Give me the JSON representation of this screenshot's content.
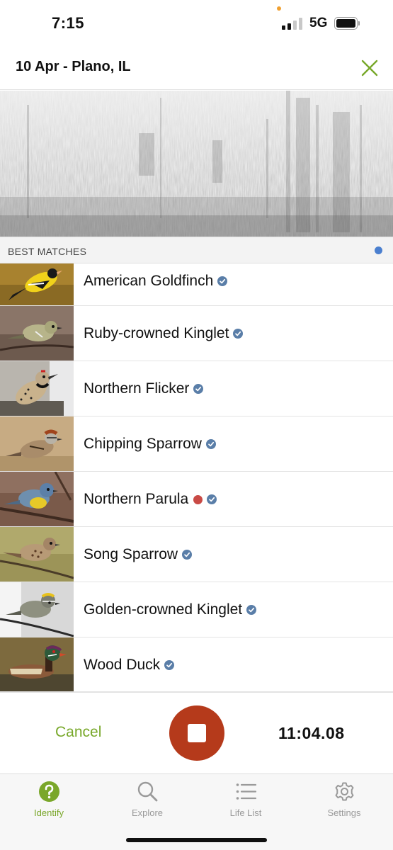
{
  "status_bar": {
    "time": "7:15",
    "network": "5G"
  },
  "header": {
    "title": "10 Apr - Plano, IL",
    "close_icon": "close-x-icon",
    "accent_color": "#78a82a"
  },
  "best_matches": {
    "title": "BEST MATCHES",
    "indicator_color": "#4a7fcf",
    "items": [
      {
        "name": "American Goldfinch",
        "verified": true,
        "new_flag": false
      },
      {
        "name": "Ruby-crowned Kinglet",
        "verified": true,
        "new_flag": false
      },
      {
        "name": "Northern Flicker",
        "verified": true,
        "new_flag": false
      },
      {
        "name": "Chipping Sparrow",
        "verified": true,
        "new_flag": false
      },
      {
        "name": "Northern Parula",
        "verified": true,
        "new_flag": true
      },
      {
        "name": "Song Sparrow",
        "verified": true,
        "new_flag": false
      },
      {
        "name": "Golden-crowned Kinglet",
        "verified": true,
        "new_flag": false
      },
      {
        "name": "Wood Duck",
        "verified": true,
        "new_flag": false
      }
    ]
  },
  "controls": {
    "cancel_label": "Cancel",
    "timer": "11:04.08",
    "record_color": "#b53a1b"
  },
  "tab_bar": {
    "tabs": [
      {
        "label": "Identify",
        "icon": "question-mark-icon",
        "active": true
      },
      {
        "label": "Explore",
        "icon": "magnifier-icon",
        "active": false
      },
      {
        "label": "Life List",
        "icon": "list-icon",
        "active": false
      },
      {
        "label": "Settings",
        "icon": "gear-icon",
        "active": false
      }
    ]
  }
}
